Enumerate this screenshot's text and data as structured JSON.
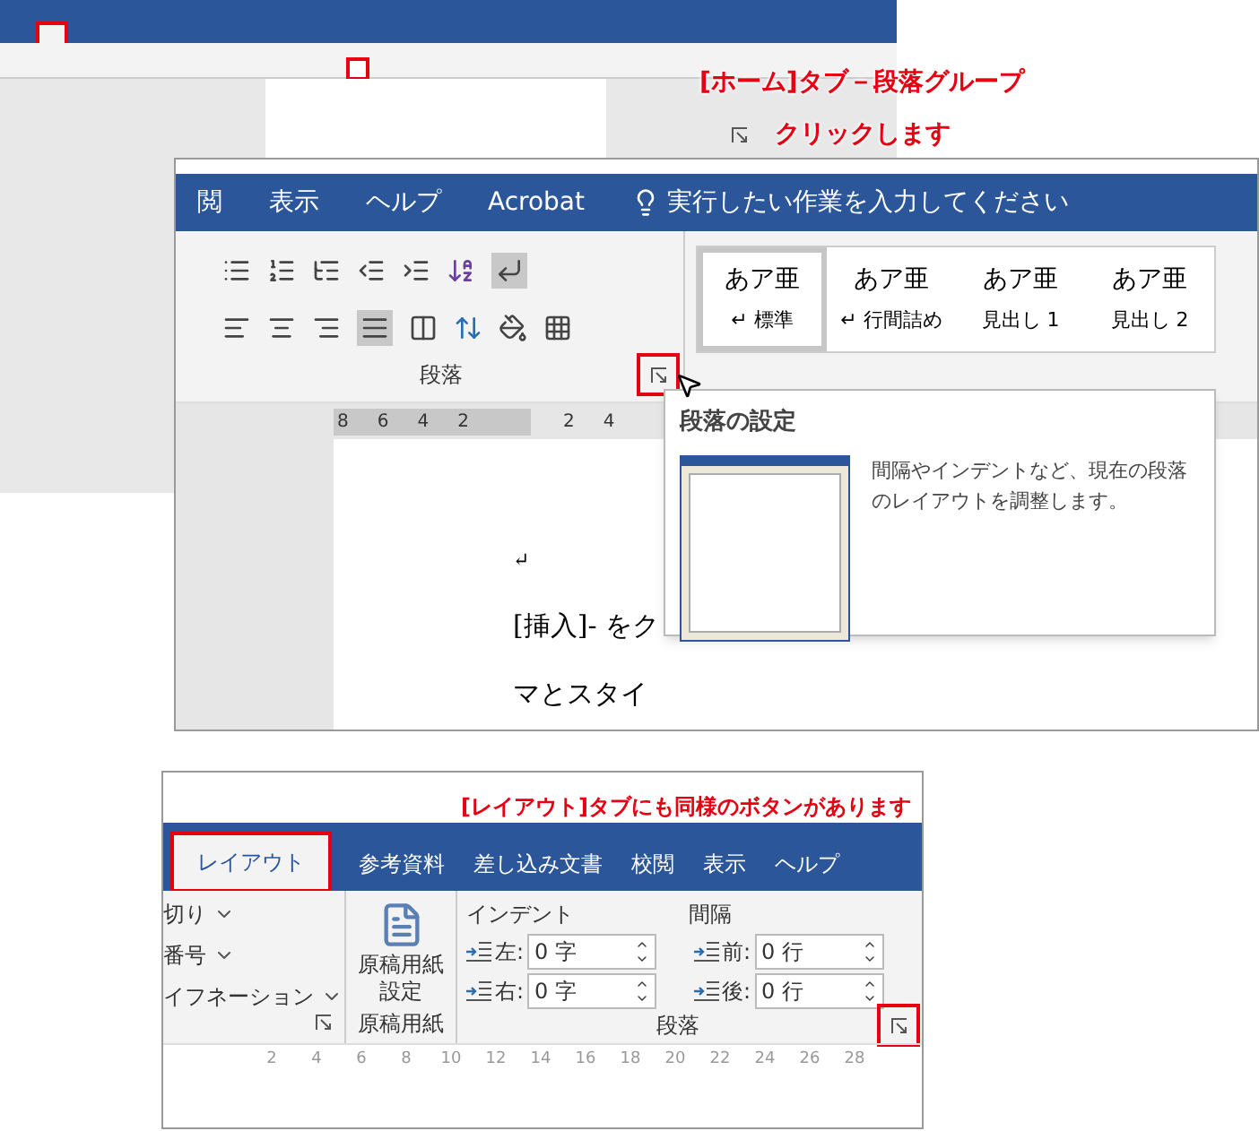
{
  "top": {
    "annotation": "[ホーム]タブ－段落グループ",
    "instruction": "クリックします"
  },
  "middle": {
    "tabs": [
      {
        "label": "閲",
        "selected": false
      },
      {
        "label": "表示",
        "selected": false
      },
      {
        "label": "ヘルプ",
        "selected": false
      },
      {
        "label": "Acrobat",
        "selected": false
      }
    ],
    "tell_me": "実行したい作業を入力してください",
    "group_label": "段落",
    "styles": [
      {
        "sample": "あア亜",
        "name": "↵ 標準",
        "selected": true
      },
      {
        "sample": "あア亜",
        "name": "↵ 行間詰め",
        "selected": false
      },
      {
        "sample": "あア亜",
        "name": "見出し 1",
        "selected": false
      },
      {
        "sample": "あア亜",
        "name": "見出し 2",
        "selected": false
      }
    ],
    "ruler": [
      "8",
      "6",
      "4",
      "2",
      "2",
      "4"
    ],
    "doc_lines": [
      "↵",
      "[挿入]- をク",
      "マとスタイ"
    ],
    "tooltip": {
      "title": "段落の設定",
      "description": "間隔やインデントなど、現在の段落のレイアウトを調整します。"
    }
  },
  "bottom": {
    "annotation": "[レイアウト]タブにも同様のボタンがあります",
    "tabs": [
      {
        "label": "レイアウト",
        "selected": true
      },
      {
        "label": "参考資料",
        "selected": false
      },
      {
        "label": "差し込み文書",
        "selected": false
      },
      {
        "label": "校閲",
        "selected": false
      },
      {
        "label": "表示",
        "selected": false
      },
      {
        "label": "ヘルプ",
        "selected": false
      }
    ],
    "page_setup_items": [
      "切り",
      "番号",
      "イフネーション"
    ],
    "manuscript_button": "原稿用紙設定",
    "manuscript_group": "原稿用紙",
    "indent_label": "インデント",
    "spacing_label": "間隔",
    "fields": [
      {
        "label": "左:",
        "value": "0 字"
      },
      {
        "label": "前:",
        "value": "0 行"
      },
      {
        "label": "右:",
        "value": "0 字"
      },
      {
        "label": "後:",
        "value": "0 行"
      }
    ],
    "group_label": "段落",
    "ruler": [
      "2",
      "4",
      "6",
      "8",
      "10",
      "12",
      "14",
      "16",
      "18",
      "20",
      "22",
      "24",
      "26",
      "28"
    ]
  }
}
